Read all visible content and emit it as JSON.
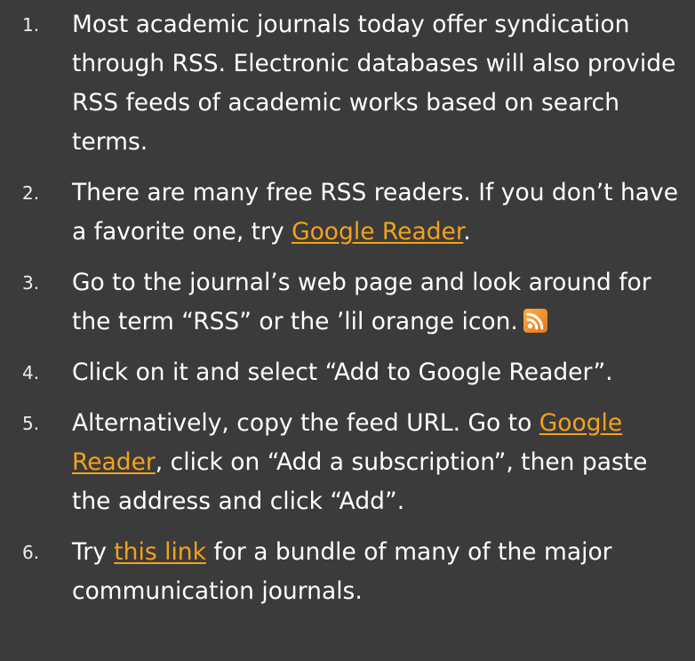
{
  "colors": {
    "background": "#3b3b3b",
    "text": "#ffffff",
    "link": "#f4a21c",
    "rss_icon": "#f58a1f"
  },
  "steps": [
    {
      "number": "1.",
      "text": "Most academic journals today offer syndication through RSS. Electronic databases will also provide RSS feeds of academic works based on search terms."
    },
    {
      "number": "2.",
      "before": "There are many free RSS readers. If you don’t have a favorite one, try ",
      "link": "Google Reader",
      "after": "."
    },
    {
      "number": "3.",
      "text": "Go to the journal’s web page and look around for the term “RSS” or the ’lil orange icon.",
      "icon": "rss-icon"
    },
    {
      "number": "4.",
      "text": "Click on it and select “Add to Google Reader”."
    },
    {
      "number": "5.",
      "before": "Alternatively, copy the feed URL. Go to ",
      "link": "Google Reader",
      "after": ", click on “Add a subscription”, then paste the address and click “Add”."
    },
    {
      "number": "6.",
      "before": "Try ",
      "link": "this link",
      "after": " for a bundle of many of the major communication journals."
    }
  ]
}
